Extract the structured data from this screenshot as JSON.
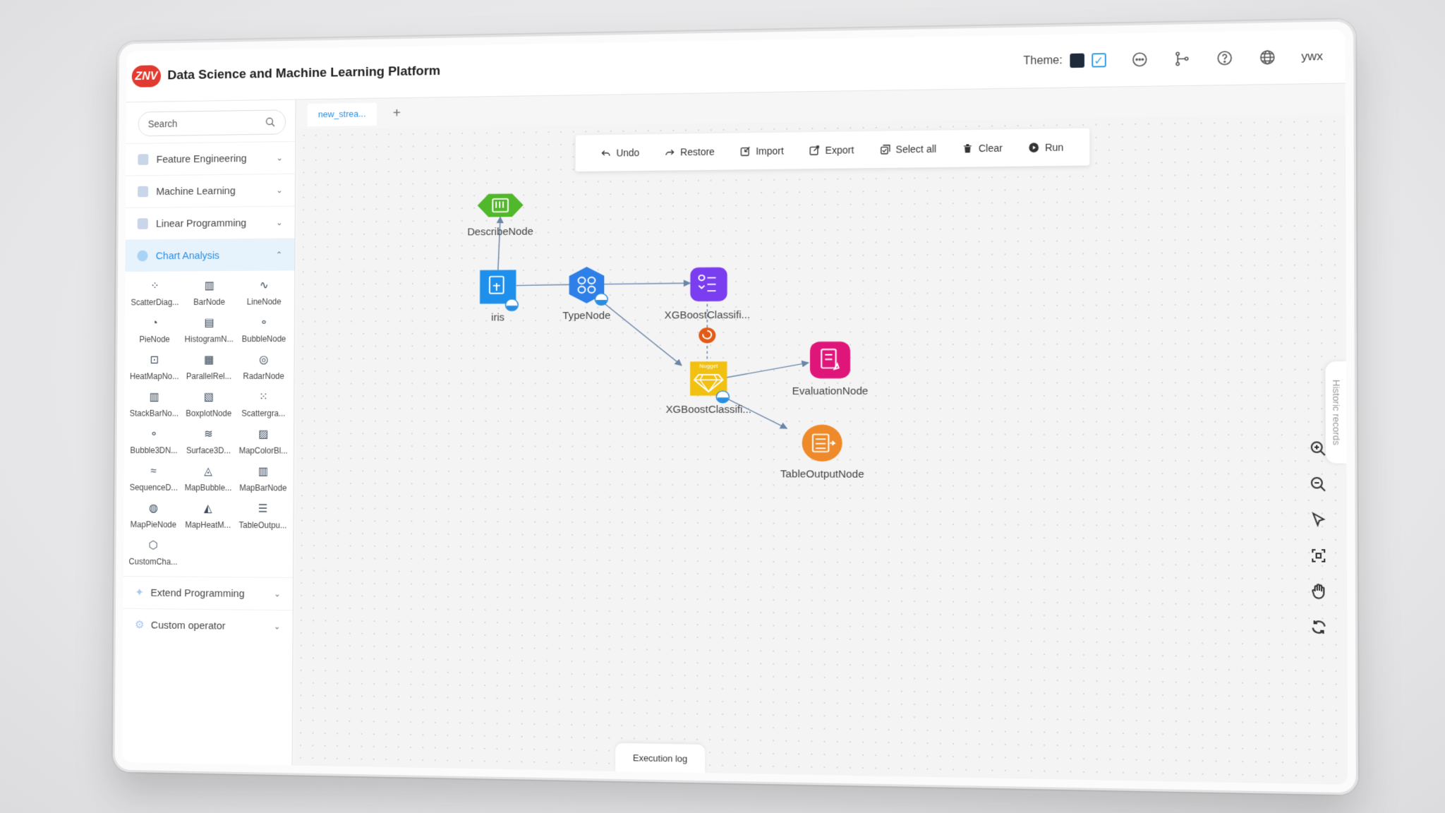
{
  "header": {
    "logo_text": "ZNV",
    "title": "Data Science and Machine Learning Platform",
    "theme_label": "Theme:",
    "user": "ywx"
  },
  "sidebar": {
    "search_placeholder": "Search",
    "categories": [
      {
        "label": "Feature Engineering",
        "expanded": false
      },
      {
        "label": "Machine Learning",
        "expanded": false
      },
      {
        "label": "Linear Programming",
        "expanded": false
      },
      {
        "label": "Chart Analysis",
        "expanded": true
      }
    ],
    "chart_nodes": [
      "ScatterDiag...",
      "BarNode",
      "LineNode",
      "PieNode",
      "HistogramN...",
      "BubbleNode",
      "HeatMapNo...",
      "ParallelRel...",
      "RadarNode",
      "StackBarNo...",
      "BoxplotNode",
      "Scattergra...",
      "Bubble3DN...",
      "Surface3D...",
      "MapColorBl...",
      "SequenceD...",
      "MapBubble...",
      "MapBarNode",
      "MapPieNode",
      "MapHeatM...",
      "TableOutpu...",
      "CustomCha..."
    ],
    "bottom_categories": [
      {
        "label": "Extend Programming"
      },
      {
        "label": "Custom operator"
      }
    ]
  },
  "tabs": {
    "active": "new_strea...",
    "add": "+"
  },
  "toolbar": {
    "undo": "Undo",
    "restore": "Restore",
    "import": "Import",
    "export": "Export",
    "select_all": "Select all",
    "clear": "Clear",
    "run": "Run"
  },
  "flow": {
    "nodes": {
      "describe": "DescribeNode",
      "iris": "iris",
      "type": "TypeNode",
      "xgb_model": "XGBoostClassifi...",
      "nugget": "Nugget",
      "xgb_nugget": "XGBoostClassifi...",
      "evaluation": "EvaluationNode",
      "table_output": "TableOutputNode"
    }
  },
  "side_panel": "Historic records",
  "execution_log": "Execution log",
  "colors": {
    "accent": "#2a8ee0",
    "describe": "#52b82b",
    "iris": "#1e8fea",
    "type": "#2f7fe8",
    "xgb": "#7a3ef0",
    "nugget": "#f2c010",
    "evaluation": "#e0157a",
    "table_output": "#ef8a2a"
  }
}
